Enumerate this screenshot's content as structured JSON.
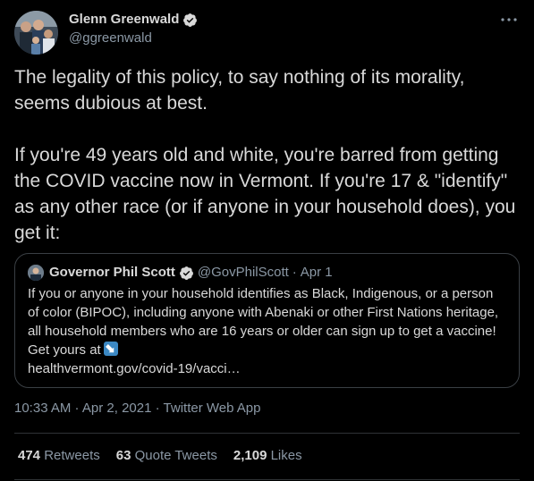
{
  "author": {
    "name": "Glenn Greenwald",
    "handle": "@ggreenwald",
    "verified": true
  },
  "more_label": "···",
  "tweet": {
    "paragraphs": [
      "The legality of this policy, to say nothing of its morality, seems dubious at best.",
      "If you're 49 years old and white, you're barred from getting the COVID vaccine now in Vermont. If you're 17 & \"identify\" as any other race (or if anyone in your household does), you get it:"
    ]
  },
  "quote": {
    "name": "Governor Phil Scott",
    "handle": "@GovPhilScott",
    "separator": "·",
    "date": "Apr 1",
    "text": "If you or anyone in your household identifies as Black, Indigenous, or a person of color (BIPOC), including anyone with Abenaki or other First Nations heritage, all household members who are 16 years or older can sign up to get a vaccine! Get yours at",
    "link": "healthvermont.gov/covid-19/vacci…"
  },
  "meta": {
    "time": "10:33 AM",
    "separator1": " · ",
    "date": "Apr 2, 2021",
    "separator2": " · ",
    "app": "Twitter Web App"
  },
  "stats": {
    "retweets": {
      "count": "474",
      "label": "Retweets"
    },
    "quotes": {
      "count": "63",
      "label": "Quote Tweets"
    },
    "likes": {
      "count": "2,109",
      "label": "Likes"
    }
  },
  "colors": {
    "background": "#000000",
    "text": "#d9d9d9",
    "secondary": "#8b98a5",
    "border": "#3a3f44",
    "verified": "#d9d9d9",
    "link_emoji": "#3b88c3"
  },
  "icons": {
    "verified": "verified-badge-icon",
    "more": "more-options-icon",
    "link_emoji": "arrow-down-right-emoji-icon"
  }
}
